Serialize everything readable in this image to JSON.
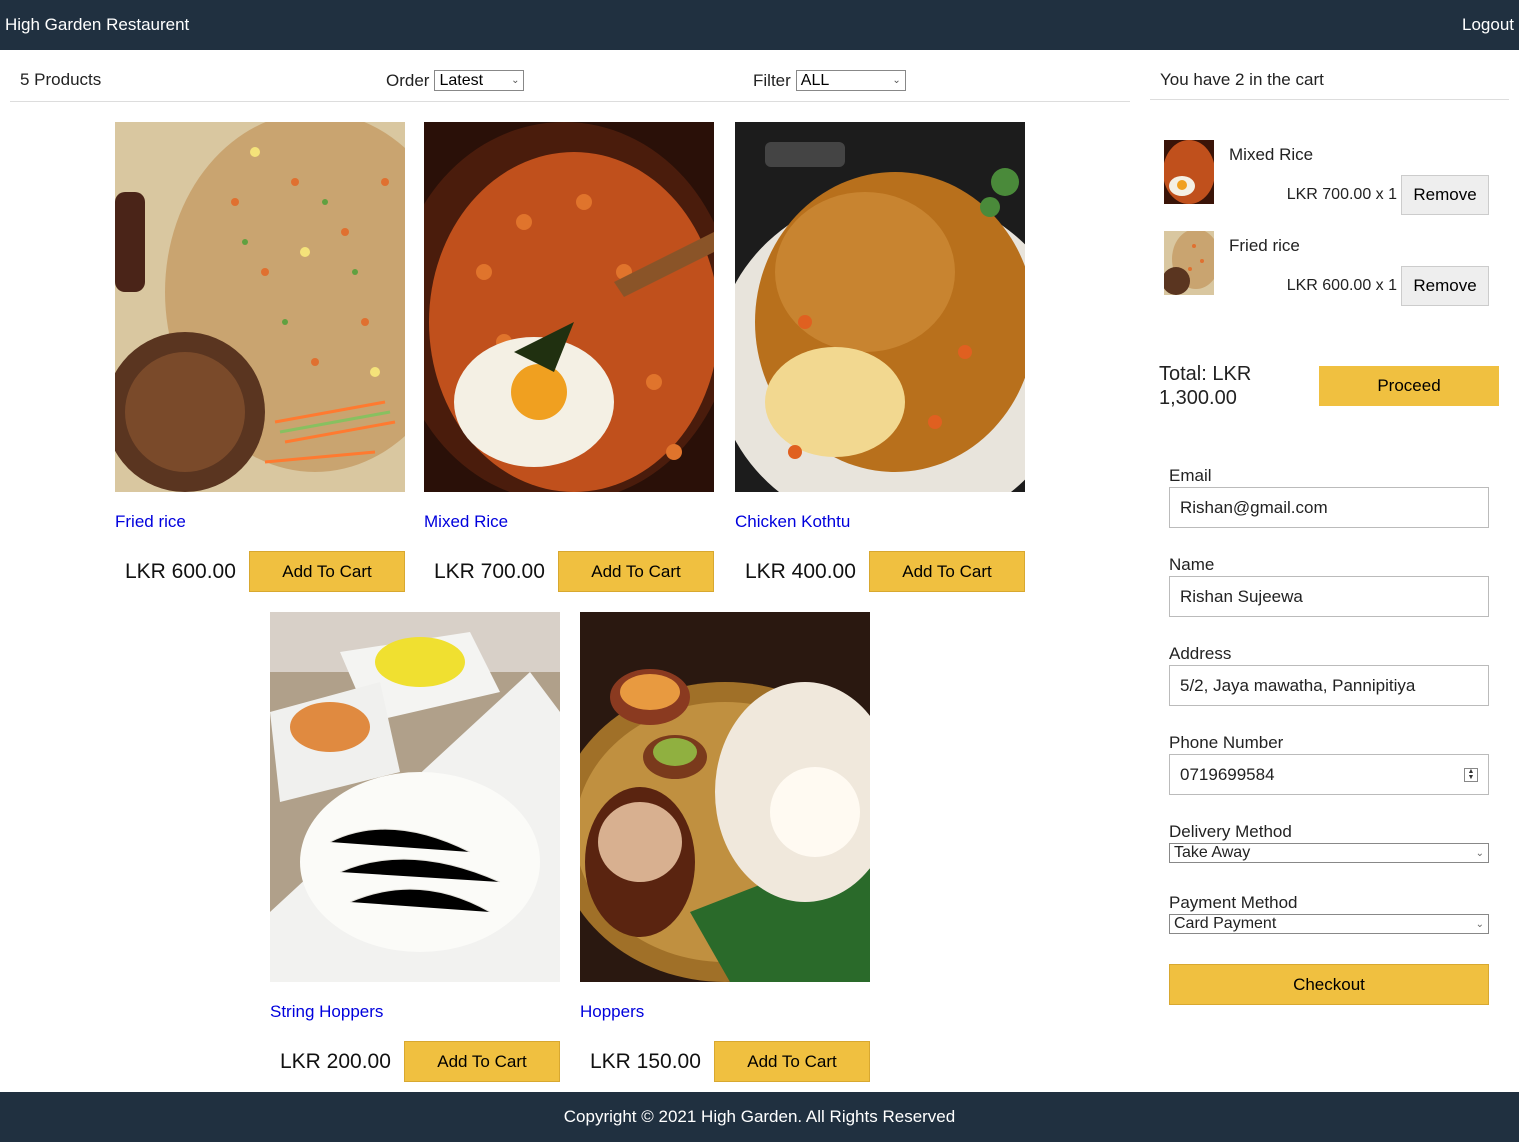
{
  "header": {
    "brand": "High Garden Restaurent",
    "logout_label": "Logout"
  },
  "toolbar": {
    "product_count": "5 Products",
    "order_label": "Order",
    "order_value": "Latest",
    "filter_label": "Filter",
    "filter_value": "ALL"
  },
  "products": [
    {
      "name": "Fried rice",
      "price": "LKR 600.00",
      "add_label": "Add To Cart",
      "image": "fried-rice-photo"
    },
    {
      "name": "Mixed Rice",
      "price": "LKR 700.00",
      "add_label": "Add To Cart",
      "image": "mixed-rice-photo"
    },
    {
      "name": "Chicken Kothtu",
      "price": "LKR 400.00",
      "add_label": "Add To Cart",
      "image": "chicken-kothtu-photo"
    },
    {
      "name": "String Hoppers",
      "price": "LKR 200.00",
      "add_label": "Add To Cart",
      "image": "string-hoppers-photo"
    },
    {
      "name": "Hoppers",
      "price": "LKR 150.00",
      "add_label": "Add To Cart",
      "image": "hoppers-photo"
    }
  ],
  "cart": {
    "summary": "You have 2 in the cart",
    "items": [
      {
        "name": "Mixed Rice",
        "qty_text": "LKR 700.00 x 1",
        "remove_label": "Remove"
      },
      {
        "name": "Fried rice",
        "qty_text": "LKR 600.00 x 1",
        "remove_label": "Remove"
      }
    ],
    "total_text": "Total: LKR 1,300.00",
    "proceed_label": "Proceed"
  },
  "checkout_form": {
    "email_label": "Email",
    "email_value": "Rishan@gmail.com",
    "name_label": "Name",
    "name_value": "Rishan Sujeewa",
    "address_label": "Address",
    "address_value": "5/2, Jaya mawatha, Pannipitiya",
    "phone_label": "Phone Number",
    "phone_value": "0719699584",
    "delivery_label": "Delivery Method",
    "delivery_value": "Take Away",
    "payment_label": "Payment Method",
    "payment_value": "Card Payment",
    "checkout_label": "Checkout"
  },
  "footer": {
    "copyright": "Copyright © 2021 High Garden. All Rights Reserved"
  },
  "colors": {
    "header_bg": "#203040",
    "accent_button": "#f0c040",
    "link": "#0000dd"
  }
}
